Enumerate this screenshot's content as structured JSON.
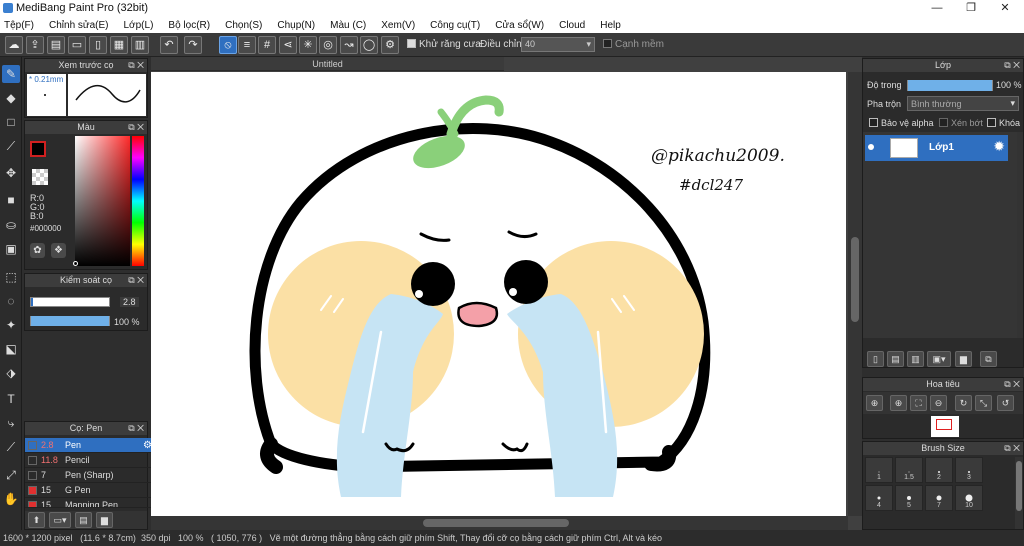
{
  "window": {
    "title": "MediBang Paint Pro (32bit)",
    "minimize": "—",
    "maximize": "❐",
    "close": "✕"
  },
  "menu": [
    "Tệp(F)",
    "Chỉnh sửa(E)",
    "Lớp(L)",
    "Bộ lọc(R)",
    "Chọn(S)",
    "Chụp(N)",
    "Màu (C)",
    "Xem(V)",
    "Công cụ(T)",
    "Cửa sổ(W)",
    "Cloud",
    "Help"
  ],
  "toolbar": {
    "antialias_label": "Khử răng cưa",
    "adjust_label": "Điều chỉnh",
    "adjust_value": "40",
    "edge_label": "Cạnh mềm"
  },
  "doc": {
    "tab_title": "Untitled"
  },
  "brush_preview": {
    "title": "Xem trước cọ",
    "size": "0.21mm"
  },
  "color": {
    "title": "Màu",
    "r": "R:0",
    "g": "G:0",
    "b": "B:0",
    "hex": "#000000",
    "fg": "#000000",
    "accent": "#2f6fc0"
  },
  "brush_control": {
    "title": "Kiểm soát cọ",
    "size": "2.8",
    "opacity": "100 %",
    "opacity_level": 1.0
  },
  "brush_list": {
    "title": "Cọ: Pen",
    "items": [
      {
        "num": "2.8",
        "name": "Pen",
        "color": "#222222"
      },
      {
        "num": "11.8",
        "name": "Pencil",
        "color": "#222222"
      },
      {
        "num": "7",
        "name": "Pen (Sharp)",
        "color": "#222222"
      },
      {
        "num": "15",
        "name": "G Pen",
        "color": "#e03030"
      },
      {
        "num": "15",
        "name": "Mapping Pen",
        "color": "#e03030"
      }
    ]
  },
  "layer_panel": {
    "title": "Lớp",
    "opacity_label": "Độ trong",
    "opacity_value": "100 %",
    "opacity_level": 1.0,
    "blend_label": "Pha trộn",
    "blend_value": "Bình thường",
    "protect_alpha": "Bảo vệ alpha",
    "clipping": "Xén bớt",
    "lock": "Khóa",
    "layer_name": "Lớp1"
  },
  "navigator": {
    "title": "Hoa tiêu"
  },
  "brush_size": {
    "title": "Brush Size",
    "row1": [
      "1",
      "1.5",
      "2",
      "3"
    ],
    "row2": [
      "4",
      "5",
      "7",
      "10"
    ]
  },
  "drawing": {
    "signature_line1": "@pikachu2009.",
    "signature_line2": "#dcl247"
  },
  "status": {
    "dims": "1600 * 1200 pixel",
    "cm": "(11.6 * 8.7cm)",
    "dpi": "350 dpi",
    "zoom": "100 %",
    "coords": "( 1050, 776 )",
    "hint": "Vẽ một đường thẳng bằng cách giữ phím Shift, Thay đổi cỡ cọ bằng cách giữ phím Ctrl, Alt và kéo"
  }
}
